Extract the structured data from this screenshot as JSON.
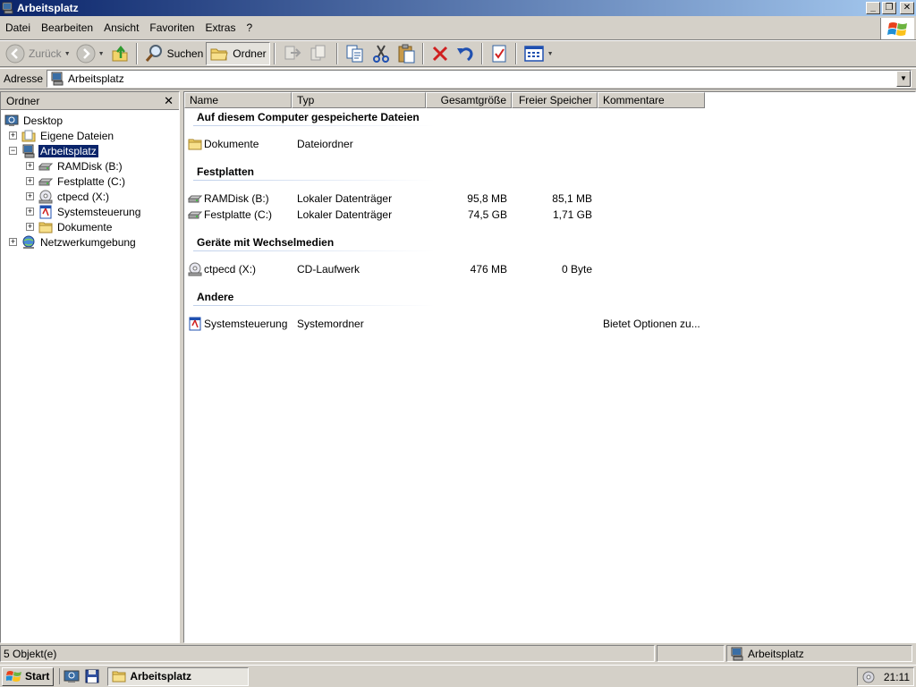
{
  "window": {
    "title": "Arbeitsplatz"
  },
  "menu": {
    "items": [
      {
        "label": "Datei"
      },
      {
        "label": "Bearbeiten"
      },
      {
        "label": "Ansicht"
      },
      {
        "label": "Favoriten"
      },
      {
        "label": "Extras"
      },
      {
        "label": "?"
      }
    ]
  },
  "toolbar": {
    "back_label": "Zurück",
    "search_label": "Suchen",
    "folders_label": "Ordner"
  },
  "address": {
    "label": "Adresse",
    "value": "Arbeitsplatz"
  },
  "folder_pane": {
    "title": "Ordner",
    "close_glyph": "✕",
    "tree": [
      {
        "label": "Desktop",
        "expander": "",
        "icon": "desktop-icon"
      },
      {
        "label": "Eigene Dateien",
        "expander": "+",
        "icon": "my-documents-icon"
      },
      {
        "label": "Arbeitsplatz",
        "expander": "−",
        "icon": "my-computer-icon",
        "selected": true
      },
      {
        "label": "RAMDisk (B:)",
        "expander": "+",
        "icon": "hard-drive-icon"
      },
      {
        "label": "Festplatte (C:)",
        "expander": "+",
        "icon": "hard-drive-icon"
      },
      {
        "label": "ctpecd (X:)",
        "expander": "+",
        "icon": "cd-drive-icon"
      },
      {
        "label": "Systemsteuerung",
        "expander": "+",
        "icon": "control-panel-icon"
      },
      {
        "label": "Dokumente",
        "expander": "+",
        "icon": "folder-icon"
      },
      {
        "label": "Netzwerkumgebung",
        "expander": "+",
        "icon": "network-icon"
      }
    ]
  },
  "content": {
    "columns": [
      {
        "label": "Name"
      },
      {
        "label": "Typ"
      },
      {
        "label": "Gesamtgröße"
      },
      {
        "label": "Freier Speicher"
      },
      {
        "label": "Kommentare"
      }
    ],
    "groups": [
      {
        "title": "Auf diesem Computer gespeicherte Dateien",
        "items": [
          {
            "name": "Dokumente",
            "type": "Dateiordner",
            "total": "",
            "free": "",
            "comment": "",
            "icon": "folder-icon"
          }
        ]
      },
      {
        "title": "Festplatten",
        "items": [
          {
            "name": "RAMDisk (B:)",
            "type": "Lokaler Datenträger",
            "total": "95,8 MB",
            "free": "85,1 MB",
            "comment": "",
            "icon": "hard-drive-icon"
          },
          {
            "name": "Festplatte (C:)",
            "type": "Lokaler Datenträger",
            "total": "74,5 GB",
            "free": "1,71 GB",
            "comment": "",
            "icon": "hard-drive-icon"
          }
        ]
      },
      {
        "title": "Geräte mit Wechselmedien",
        "items": [
          {
            "name": "ctpecd (X:)",
            "type": "CD-Laufwerk",
            "total": "476 MB",
            "free": "0 Byte",
            "comment": "",
            "icon": "cd-drive-icon"
          }
        ]
      },
      {
        "title": "Andere",
        "items": [
          {
            "name": "Systemsteuerung",
            "type": "Systemordner",
            "total": "",
            "free": "",
            "comment": "Bietet Optionen zu...",
            "icon": "control-panel-icon"
          }
        ]
      }
    ]
  },
  "status": {
    "count": "5 Objekt(e)",
    "location": "Arbeitsplatz"
  },
  "taskbar": {
    "start_label": "Start",
    "task_label": "Arbeitsplatz",
    "clock": "21:11"
  },
  "colors": {
    "titlebar_start": "#0a246a",
    "titlebar_end": "#a6caf0",
    "selection": "#0a246a",
    "face": "#d4d0c8"
  }
}
